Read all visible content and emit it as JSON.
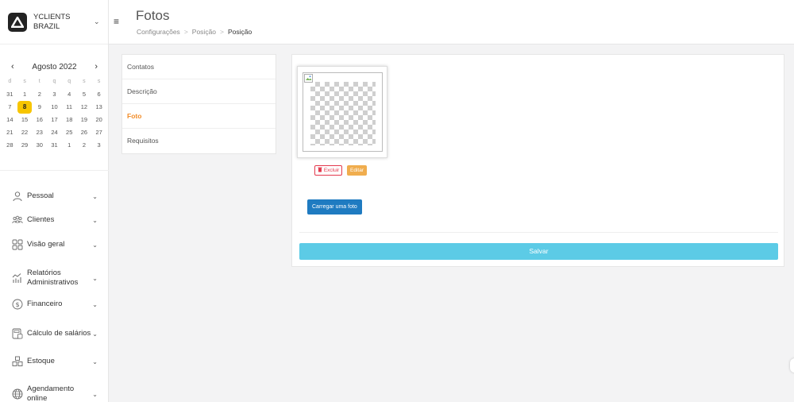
{
  "brand": {
    "name": "YCLIENTS BRAZIL"
  },
  "calendar": {
    "month_label": "Agosto 2022",
    "weekdays": [
      "d",
      "s",
      "t",
      "q",
      "q",
      "s",
      "s"
    ],
    "weeks": [
      [
        "31",
        "1",
        "2",
        "3",
        "4",
        "5",
        "6"
      ],
      [
        "7",
        "8",
        "9",
        "10",
        "11",
        "12",
        "13"
      ],
      [
        "14",
        "15",
        "16",
        "17",
        "18",
        "19",
        "20"
      ],
      [
        "21",
        "22",
        "23",
        "24",
        "25",
        "26",
        "27"
      ],
      [
        "28",
        "29",
        "30",
        "31",
        "1",
        "2",
        "3"
      ]
    ],
    "today": "8",
    "today_color": "#f7c500"
  },
  "menu": [
    {
      "label": "Pessoal",
      "icon": "person-icon"
    },
    {
      "label": "Clientes",
      "icon": "clients-icon"
    },
    {
      "label": "Visão geral",
      "icon": "grid-icon"
    },
    {
      "label": "Relatórios Administrativos",
      "icon": "reports-icon"
    },
    {
      "label": "Financeiro",
      "icon": "dollar-icon"
    },
    {
      "label": "Cálculo de salários",
      "icon": "calculator-icon"
    },
    {
      "label": "Estoque",
      "icon": "warehouse-icon"
    },
    {
      "label": "Agendamento online",
      "icon": "globe-icon"
    }
  ],
  "header": {
    "title": "Fotos",
    "breadcrumb": [
      "Configurações",
      "Posição",
      "Posição"
    ]
  },
  "tabs": [
    {
      "label": "Contatos",
      "active": false
    },
    {
      "label": "Descrição",
      "active": false
    },
    {
      "label": "Foto",
      "active": true
    },
    {
      "label": "Requisitos",
      "active": false
    }
  ],
  "photo": {
    "delete_label": "Excluir",
    "edit_label": "Editar",
    "upload_label": "Carregar uma foto"
  },
  "save_label": "Salvar",
  "colors": {
    "accent": "#f28c28",
    "save": "#5ccbe6",
    "upload": "#1f7bc1",
    "delete": "#e3394d",
    "edit": "#f0ad4e"
  }
}
